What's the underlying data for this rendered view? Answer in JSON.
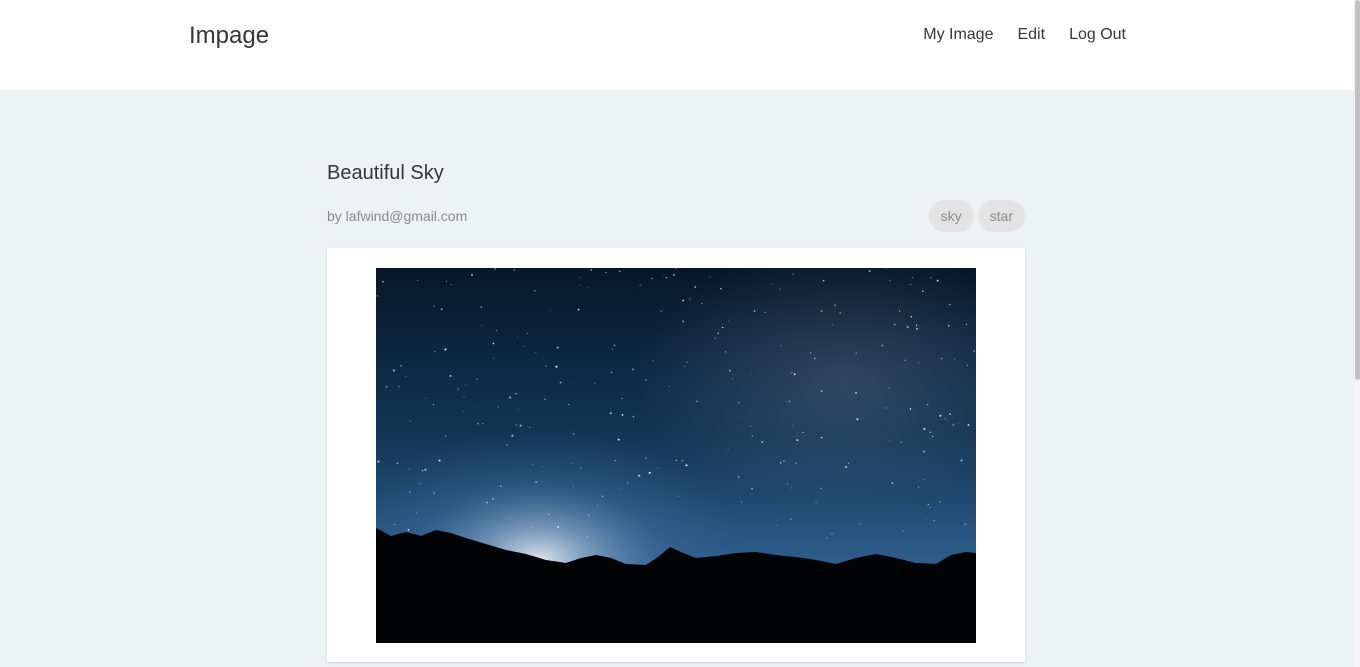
{
  "navbar": {
    "brand": "Impage",
    "links": [
      "My Image",
      "Edit",
      "Log Out"
    ]
  },
  "post": {
    "title": "Beautiful Sky",
    "author": "by lafwind@gmail.com",
    "tags": [
      "sky",
      "star"
    ]
  },
  "colors": {
    "page_background": "#edf2f4",
    "navbar_background": "#ffffff",
    "text": "#363636",
    "muted_text": "#8a8a8a",
    "tag_background": "#e3e3e3"
  }
}
